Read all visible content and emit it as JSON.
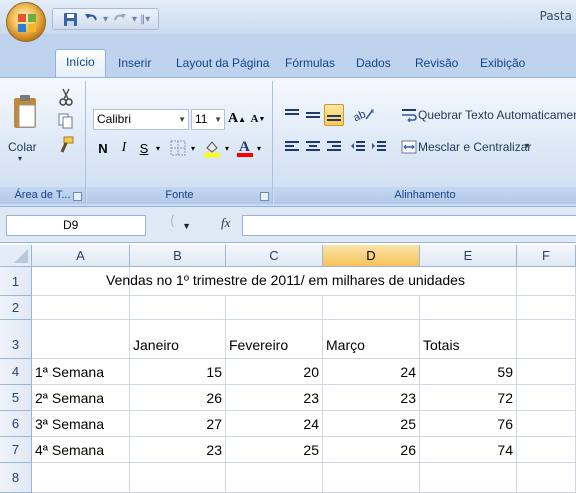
{
  "app": {
    "title": "Pasta"
  },
  "quick_access": {
    "icons": [
      "save-icon",
      "undo-icon",
      "redo-icon",
      "customize-qat-icon"
    ]
  },
  "tabs": [
    "Início",
    "Inserir",
    "Layout da Página",
    "Fórmulas",
    "Dados",
    "Revisão",
    "Exibição"
  ],
  "active_tab": "Início",
  "ribbon": {
    "clipboard": {
      "paste_label": "Colar",
      "group_label": "Área de T..."
    },
    "font": {
      "font_name": "Calibri",
      "font_size": "11",
      "bold": "N",
      "italic": "I",
      "underline": "S",
      "group_label": "Fonte",
      "font_color": "#ff0000",
      "highlight_color": "#ffff00"
    },
    "alignment": {
      "wrap_text_label": "Quebrar Texto Automaticamente",
      "merge_label": "Mesclar e Centralizar",
      "group_label": "Alinhamento"
    }
  },
  "formula_bar": {
    "name_box": "D9",
    "fx_label": "fx",
    "formula": ""
  },
  "sheet": {
    "columns": [
      "A",
      "B",
      "C",
      "D",
      "E",
      "F"
    ],
    "selected_column": "D",
    "rows": [
      "1",
      "2",
      "3",
      "4",
      "5",
      "6",
      "7",
      "8"
    ],
    "title": "Vendas no 1º trimestre de 2011/ em milhares de unidades",
    "headers": [
      "",
      "Janeiro",
      "Fevereiro",
      "Março",
      "Totais"
    ],
    "data": [
      {
        "week": "1ª Semana",
        "jan": "15",
        "fev": "20",
        "mar": "24",
        "total": "59"
      },
      {
        "week": "2ª Semana",
        "jan": "26",
        "fev": "23",
        "mar": "23",
        "total": "72"
      },
      {
        "week": "3ª Semana",
        "jan": "27",
        "fev": "24",
        "mar": "25",
        "total": "76"
      },
      {
        "week": "4ª Semana",
        "jan": "23",
        "fev": "25",
        "mar": "26",
        "total": "74"
      }
    ]
  },
  "colors": {
    "ribbon_bg": "#dde8f6",
    "tab_bar": "#bfd3ee",
    "selected_header": "#f5c35b",
    "grid_line": "#d0d7e5"
  }
}
